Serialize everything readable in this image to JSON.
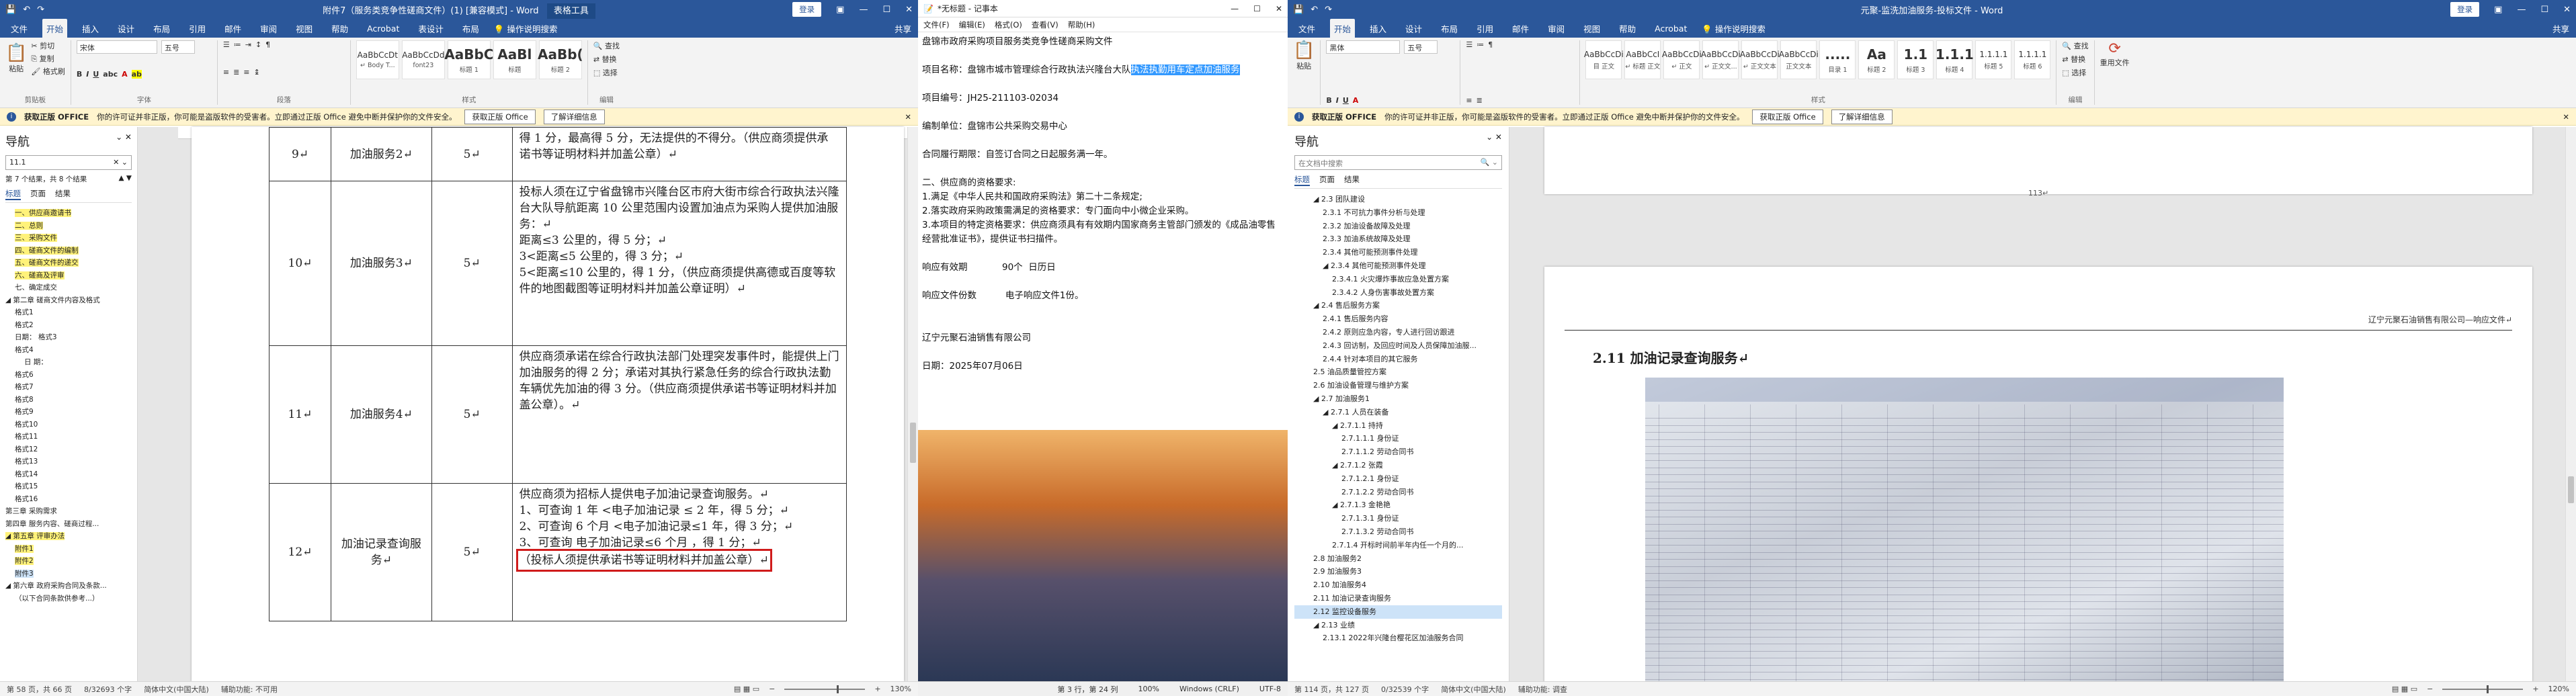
{
  "left_word": {
    "title": "附件7（服务类竞争性磋商文件）(1) [兼容模式] - Word",
    "tools_tab": "表格工具",
    "login_btn": "登录",
    "tabs": [
      "文件",
      "开始",
      "插入",
      "设计",
      "布局",
      "引用",
      "邮件",
      "审阅",
      "视图",
      "帮助",
      "Acrobat",
      "表设计",
      "布局"
    ],
    "tell_me": "操作说明搜索",
    "share": "共享",
    "ribbon": {
      "paste": "粘贴",
      "cut": "剪切",
      "copy": "复制",
      "format_painter": "格式刷",
      "clipboard": "剪贴板",
      "font_name": "宋体",
      "font_size": "五号",
      "font_group": "字体",
      "para_group": "段落",
      "styles_group": "样式",
      "editing_group": "编辑",
      "find": "查找",
      "replace": "替换",
      "select": "选择",
      "styles": [
        {
          "preview": "AaBbCcDt",
          "name": "↵ Body T..."
        },
        {
          "preview": "AaBbCcDd",
          "name": "font23"
        },
        {
          "preview": "AaBbC",
          "name": "标题 1"
        },
        {
          "preview": "AaBl",
          "name": "标题"
        },
        {
          "preview": "AaBb(",
          "name": "标题 2"
        }
      ]
    },
    "msgbar": {
      "label": "获取正版 OFFICE",
      "text": "你的许可证并非正版，你可能是盗版软件的受害者。立即通过正版 Office 避免中断并保护你的文件安全。",
      "btn1": "获取正版 Office",
      "btn2": "了解详细信息"
    },
    "nav": {
      "title": "导航",
      "search": "11.1",
      "results": "第 7 个结果，共 8 个结果",
      "tabs": [
        "标题",
        "页面",
        "结果"
      ],
      "items": [
        {
          "text": "一、供应商邀请书",
          "hl": true,
          "indent": 1
        },
        {
          "text": "二、总则",
          "hl": true,
          "indent": 1
        },
        {
          "text": "三、采购文件",
          "hl": true,
          "indent": 1
        },
        {
          "text": "四、磋商文件的编制",
          "hl": true,
          "indent": 1
        },
        {
          "text": "五、磋商文件的递交",
          "hl": true,
          "indent": 1
        },
        {
          "text": "六、磋商及评审",
          "hl": true,
          "indent": 1
        },
        {
          "text": "七、确定成交",
          "hl": false,
          "indent": 1
        },
        {
          "text": "◢ 第二章 磋商文件内容及格式",
          "hl": false,
          "indent": 0
        },
        {
          "text": "格式1",
          "hl": false,
          "indent": 1
        },
        {
          "text": "格式2",
          "hl": false,
          "indent": 1
        },
        {
          "text": "日期：  格式3",
          "hl": false,
          "indent": 1
        },
        {
          "text": "格式4",
          "hl": false,
          "indent": 1
        },
        {
          "text": "日      期：",
          "hl": false,
          "indent": 2
        },
        {
          "text": "格式6",
          "hl": false,
          "indent": 1
        },
        {
          "text": "格式7",
          "hl": false,
          "indent": 1
        },
        {
          "text": "格式8",
          "hl": false,
          "indent": 1
        },
        {
          "text": "格式9",
          "hl": false,
          "indent": 1
        },
        {
          "text": "格式10",
          "hl": false,
          "indent": 1
        },
        {
          "text": "格式11",
          "hl": false,
          "indent": 1
        },
        {
          "text": "格式12",
          "hl": false,
          "indent": 1
        },
        {
          "text": "格式13",
          "hl": false,
          "indent": 1
        },
        {
          "text": "格式14",
          "hl": false,
          "indent": 1
        },
        {
          "text": "格式15",
          "hl": false,
          "indent": 1
        },
        {
          "text": "格式16",
          "hl": false,
          "indent": 1
        },
        {
          "text": "第三章 采购需求",
          "hl": false,
          "indent": 0
        },
        {
          "text": "第四章 服务内容、磋商过程...",
          "hl": false,
          "indent": 0
        },
        {
          "text": "◢ 第五章 评审办法",
          "hl": true,
          "indent": 0
        },
        {
          "text": "附件1",
          "hl": true,
          "indent": 1
        },
        {
          "text": "附件2",
          "hl": true,
          "indent": 1
        },
        {
          "text": "附件3",
          "hl": false,
          "sel": true,
          "indent": 1
        },
        {
          "text": "◢ 第六章 政府采购合同及条款...",
          "hl": false,
          "indent": 0
        },
        {
          "text": "（以下合同条款供参考...）",
          "hl": false,
          "indent": 1
        }
      ]
    },
    "table": {
      "rows": [
        {
          "no": "9↵",
          "name": "加油服务2↵",
          "score": "5↵",
          "content": "得 1 分，最高得 5 分，无法提供的不得分。（供应商须提供承诺书等证明材料并加盖公章）↵"
        },
        {
          "no": "10↵",
          "name": "加油服务3↵",
          "score": "5↵",
          "content": "投标人须在辽宁省盘锦市兴隆台区市府大街市综合行政执法兴隆台大队导航距离 10 公里范围内设置加油点为采购人提供加油服务：↵\n距离≤3 公里的，得 5 分；↵\n3<距离≤5 公里的，得 3 分；↵\n5<距离≤10 公里的，得 1 分，（供应商须提供高德或百度等软件的地图截图等证明材料并加盖公章证明）↵"
        },
        {
          "no": "11↵",
          "name": "加油服务4↵",
          "score": "5↵",
          "content": "供应商须承诺在综合行政执法部门处理突发事件时，能提供上门加油服务的得 2 分；承诺对其执行紧急任务的综合行政执法勤车辆优先加油的得 3 分。（供应商须提供承诺书等证明材料并加盖公章）。↵"
        },
        {
          "no": "12↵",
          "name": "加油记录查询服务↵",
          "score": "5↵",
          "content": "供应商须为招标人提供电子加油记录查询服务。↵\n1、可查询 1 年 <电子加油记录 ≤ 2 年，得 5 分；↵\n2、可查询 6 个月 <电子加油记录≤1 年，得 3 分；↵\n3、可查询 电子加油记录≤6 个月 ，得 1 分；↵",
          "boxed": "（投标人须提供承诺书等证明材料并加盖公章）↵"
        }
      ]
    },
    "status": {
      "page": "第 58 页，共 66 页",
      "words": "8/32693 个字",
      "lang": "简体中文(中国大陆)",
      "assist": "辅助功能: 不可用",
      "zoom": "130%"
    }
  },
  "notepad": {
    "title": "*无标题 - 记事本",
    "menu": [
      "文件(F)",
      "编辑(E)",
      "格式(O)",
      "查看(V)",
      "帮助(H)"
    ],
    "lines": [
      {
        "text": "盘锦市政府采购项目服务类竞争性磋商采购文件"
      },
      {
        "text": ""
      },
      {
        "pre": "项目名称：盘锦市城市管理综合行政执法兴隆台大队",
        "sel": "执法执勤用车定点加油服务"
      },
      {
        "text": ""
      },
      {
        "text": "项目编号：JH25-211103-02034"
      },
      {
        "text": ""
      },
      {
        "text": "编制单位：盘锦市公共采购交易中心"
      },
      {
        "text": ""
      },
      {
        "text": "合同履行期限：自签订合同之日起服务满一年。"
      },
      {
        "text": ""
      },
      {
        "text": "二、供应商的资格要求:"
      },
      {
        "text": "1.满足《中华人民共和国政府采购法》第二十二条规定;"
      },
      {
        "text": "2.落实政府采购政策需满足的资格要求：专门面向中小微企业采购。"
      },
      {
        "text": "3.本项目的特定资格要求：供应商须具有有效期内国家商务主管部门颁发的《成品油零售经营批准证书》，提供证书扫描件。"
      },
      {
        "text": ""
      },
      {
        "text": "响应有效期            90个  日历日"
      },
      {
        "text": ""
      },
      {
        "text": "响应文件份数          电子响应文件1份。"
      },
      {
        "text": ""
      },
      {
        "text": ""
      },
      {
        "text": "辽宁元聚石油销售有限公司"
      },
      {
        "text": ""
      },
      {
        "text": "日期：2025年07月06日"
      }
    ],
    "status": {
      "pos": "第 3 行，第 24 列",
      "zoom": "100%",
      "eol": "Windows (CRLF)",
      "enc": "UTF-8"
    }
  },
  "right_word": {
    "title": "元聚-监洗加油服务-投标文件 - Word",
    "login_btn": "登录",
    "tabs": [
      "文件",
      "开始",
      "插入",
      "设计",
      "布局",
      "引用",
      "邮件",
      "审阅",
      "视图",
      "帮助",
      "Acrobat"
    ],
    "tell_me": "操作说明搜索",
    "share": "共享",
    "ribbon": {
      "paste": "粘贴",
      "font_name": "黑体",
      "font_size": "五号",
      "styles": [
        {
          "preview": "AaBbCcDi",
          "name": "目 正文"
        },
        {
          "preview": "AaBbCcI",
          "name": "↵ 标题 正文"
        },
        {
          "preview": "AaBbCcDi",
          "name": "↵ 正文"
        },
        {
          "preview": "AaBbCcDi",
          "name": "↵ 正文文..."
        },
        {
          "preview": "AaBbCcDi",
          "name": "↵ 正文文本"
        },
        {
          "preview": "AaBbCcDi",
          "name": "正文文本"
        },
        {
          "preview": ".....",
          "name": "目录 1"
        },
        {
          "preview": "Aa",
          "name": "标题 2"
        },
        {
          "preview": "1.1",
          "name": "标题 3"
        },
        {
          "preview": "1.1.1",
          "name": "标题 4"
        },
        {
          "preview": "1.1.1.1",
          "name": "标题 5"
        },
        {
          "preview": "1.1.1.1",
          "name": "标题 6"
        }
      ],
      "find": "查找",
      "replace": "替换",
      "select": "选择",
      "editing_group": "编辑",
      "styles_group": "样式",
      "reuse": "重用文件"
    },
    "msgbar": {
      "label": "获取正版 OFFICE",
      "text": "你的许可证并非正版，你可能是盗版软件的受害者。立即通过正版 Office 避免中断并保护你的文件安全。",
      "btn1": "获取正版 Office",
      "btn2": "了解详细信息"
    },
    "nav": {
      "title": "导航",
      "search": "在文档中搜索",
      "tabs": [
        "标题",
        "页面",
        "结果"
      ],
      "items": [
        {
          "text": "◢ 2.3 团队建设",
          "indent": 2
        },
        {
          "text": "2.3.1 不可抗力事件分析与处理",
          "indent": 3
        },
        {
          "text": "2.3.2 加油设备故障及处理",
          "indent": 3
        },
        {
          "text": "2.3.3 加油系统故障及处理",
          "indent": 3
        },
        {
          "text": "2.3.4 其他可能预测事件处理",
          "indent": 3
        },
        {
          "text": "◢ 2.3.4 其他可能预测事件处理",
          "indent": 3
        },
        {
          "text": "2.3.4.1 火灾爆炸事故应急处置方案",
          "indent": 4
        },
        {
          "text": "2.3.4.2 人身伤害事故处置方案",
          "indent": 4
        },
        {
          "text": "◢ 2.4 售后服务方案",
          "indent": 2
        },
        {
          "text": "2.4.1 售后服务内容",
          "indent": 3
        },
        {
          "text": "2.4.2 原则应急内容，专人进行回访跟进",
          "indent": 3
        },
        {
          "text": "2.4.3 回访制，及回应时间及人员保障加油服...",
          "indent": 3
        },
        {
          "text": "2.4.4 针对本项目的其它服务",
          "indent": 3
        },
        {
          "text": "2.5 油品质量管控方案",
          "indent": 2
        },
        {
          "text": "2.6 加油设备管理与维护方案",
          "indent": 2
        },
        {
          "text": "◢ 2.7 加油服务1",
          "indent": 2
        },
        {
          "text": "◢ 2.7.1 人员在装备",
          "indent": 3
        },
        {
          "text": "◢ 2.7.1.1 持持",
          "indent": 4
        },
        {
          "text": "2.7.1.1.1 身份证",
          "indent": 5
        },
        {
          "text": "2.7.1.1.2 劳动合同书",
          "indent": 5
        },
        {
          "text": "◢ 2.7.1.2 张霞",
          "indent": 4
        },
        {
          "text": "2.7.1.2.1 身份证",
          "indent": 5
        },
        {
          "text": "2.7.1.2.2 劳动合同书",
          "indent": 5
        },
        {
          "text": "◢ 2.7.1.3 金艳艳",
          "indent": 4
        },
        {
          "text": "2.7.1.3.1 身份证",
          "indent": 5
        },
        {
          "text": "2.7.1.3.2 劳动合同书",
          "indent": 5
        },
        {
          "text": "2.7.1.4 开标时间前半年内任一个月的...",
          "indent": 4
        },
        {
          "text": "2.8 加油服务2",
          "indent": 2
        },
        {
          "text": "2.9 加油服务3",
          "indent": 2
        },
        {
          "text": "2.10 加油服务4",
          "indent": 2
        },
        {
          "text": "2.11 加油记录查询服务",
          "indent": 2
        },
        {
          "text": "2.12 监控设备服务",
          "indent": 2,
          "sel": true
        },
        {
          "text": "◢ 2.13 业绩",
          "indent": 2
        },
        {
          "text": "2.13.1 2022年兴隆台樱花区加油服务合同",
          "indent": 3
        }
      ]
    },
    "page_footer_num": "113↵",
    "page_header": "辽宁元聚石油销售有限公司—响应文件↵",
    "heading": "2.11  加油记录查询服务↵",
    "status": {
      "page": "第 114 页，共 127 页",
      "words": "0/32539 个字",
      "lang": "简体中文(中国大陆)",
      "assist": "辅助功能: 调查",
      "zoom": "120%"
    }
  }
}
